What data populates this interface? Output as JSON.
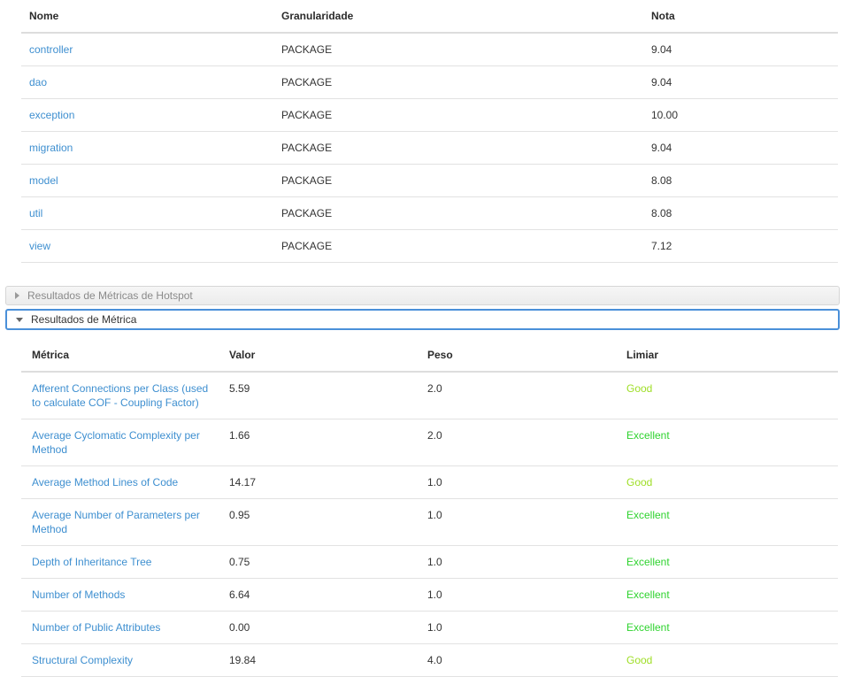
{
  "packages_table": {
    "name": "packages-results-table",
    "columns": [
      "Nome",
      "Granularidade",
      "Nota"
    ],
    "rows": [
      {
        "nome": "controller",
        "granularidade": "PACKAGE",
        "nota": "9.04"
      },
      {
        "nome": "dao",
        "granularidade": "PACKAGE",
        "nota": "9.04"
      },
      {
        "nome": "exception",
        "granularidade": "PACKAGE",
        "nota": "10.00"
      },
      {
        "nome": "migration",
        "granularidade": "PACKAGE",
        "nota": "9.04"
      },
      {
        "nome": "model",
        "granularidade": "PACKAGE",
        "nota": "8.08"
      },
      {
        "nome": "util",
        "granularidade": "PACKAGE",
        "nota": "8.08"
      },
      {
        "nome": "view",
        "granularidade": "PACKAGE",
        "nota": "7.12"
      }
    ]
  },
  "accordion": {
    "hotspot": {
      "label": "Resultados de Métricas de Hotspot",
      "state": "collapsed",
      "icon": "caret-right-icon"
    },
    "metrica": {
      "label": "Resultados de Métrica",
      "state": "expanded",
      "icon": "caret-down-icon"
    }
  },
  "metrics_table": {
    "name": "metric-results-table",
    "columns": [
      "Métrica",
      "Valor",
      "Peso",
      "Limiar"
    ],
    "rows": [
      {
        "metrica": "Afferent Connections per Class (used to calculate COF - Coupling Factor)",
        "valor": "5.59",
        "peso": "2.0",
        "limiar": "Good",
        "limiar_class": "limiar-good"
      },
      {
        "metrica": "Average Cyclomatic Complexity per Method",
        "valor": "1.66",
        "peso": "2.0",
        "limiar": "Excellent",
        "limiar_class": "limiar-excellent"
      },
      {
        "metrica": "Average Method Lines of Code",
        "valor": "14.17",
        "peso": "1.0",
        "limiar": "Good",
        "limiar_class": "limiar-good"
      },
      {
        "metrica": "Average Number of Parameters per Method",
        "valor": "0.95",
        "peso": "1.0",
        "limiar": "Excellent",
        "limiar_class": "limiar-excellent"
      },
      {
        "metrica": "Depth of Inheritance Tree",
        "valor": "0.75",
        "peso": "1.0",
        "limiar": "Excellent",
        "limiar_class": "limiar-excellent"
      },
      {
        "metrica": "Number of Methods",
        "valor": "6.64",
        "peso": "1.0",
        "limiar": "Excellent",
        "limiar_class": "limiar-excellent"
      },
      {
        "metrica": "Number of Public Attributes",
        "valor": "0.00",
        "peso": "1.0",
        "limiar": "Excellent",
        "limiar_class": "limiar-excellent"
      },
      {
        "metrica": "Structural Complexity",
        "valor": "19.84",
        "peso": "4.0",
        "limiar": "Good",
        "limiar_class": "limiar-good"
      }
    ]
  },
  "colors": {
    "link": "#3e8fd0",
    "good": "#9ede25",
    "excellent": "#2fd32f",
    "accordion_focus_border": "#4a90d9",
    "accordion_collapsed_bg": "#ececec",
    "row_border": "#e2e2e2",
    "header_border": "#dddddd"
  }
}
